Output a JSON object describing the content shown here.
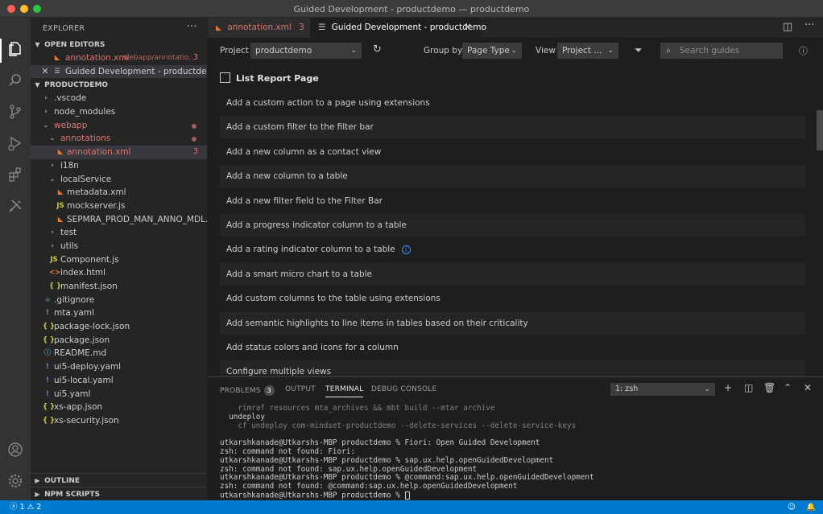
{
  "window": {
    "title": "Guided Development - productdemo — productdemo"
  },
  "sidebar": {
    "header": "EXPLORER",
    "more": "···",
    "open_editors": {
      "title": "OPEN EDITORS",
      "items": [
        {
          "name": "annotation.xml",
          "path": "webapp/annotatio...",
          "badge": "3"
        },
        {
          "name": "Guided Development - productdemo"
        }
      ]
    },
    "project": {
      "title": "PRODUCTDEMO",
      "tree": [
        {
          "label": ".vscode",
          "type": "folder"
        },
        {
          "label": "node_modules",
          "type": "folder"
        },
        {
          "label": "webapp",
          "type": "folder-open"
        },
        {
          "label": "annotations",
          "type": "folder-open"
        },
        {
          "label": "annotation.xml",
          "type": "xml",
          "badge": "3"
        },
        {
          "label": "i18n",
          "type": "folder"
        },
        {
          "label": "localService",
          "type": "folder-open"
        },
        {
          "label": "metadata.xml",
          "type": "xml"
        },
        {
          "label": "mockserver.js",
          "type": "js"
        },
        {
          "label": "SEPMRA_PROD_MAN_ANNO_MDL.xml",
          "type": "xml"
        },
        {
          "label": "test",
          "type": "folder"
        },
        {
          "label": "utils",
          "type": "folder"
        },
        {
          "label": "Component.js",
          "type": "js"
        },
        {
          "label": "index.html",
          "type": "html"
        },
        {
          "label": "manifest.json",
          "type": "json"
        },
        {
          "label": ".gitignore",
          "type": "git"
        },
        {
          "label": "mta.yaml",
          "type": "yaml"
        },
        {
          "label": "package-lock.json",
          "type": "json"
        },
        {
          "label": "package.json",
          "type": "json"
        },
        {
          "label": "README.md",
          "type": "info"
        },
        {
          "label": "ui5-deploy.yaml",
          "type": "yaml"
        },
        {
          "label": "ui5-local.yaml",
          "type": "yaml"
        },
        {
          "label": "ui5.yaml",
          "type": "yaml"
        },
        {
          "label": "xs-app.json",
          "type": "json"
        },
        {
          "label": "xs-security.json",
          "type": "json"
        }
      ]
    },
    "outline": "OUTLINE",
    "npm_scripts": "NPM SCRIPTS"
  },
  "tabs": [
    {
      "label": "annotation.xml",
      "badge": "3"
    },
    {
      "label": "Guided Development - productdemo"
    }
  ],
  "toolbar": {
    "project_label": "Project",
    "project_value": "productdemo",
    "group_by_label": "Group by",
    "group_by_value": "Page Type",
    "view_label": "View",
    "view_value": "Project ...",
    "search_placeholder": "Search guides"
  },
  "guides": {
    "section_title": "List Report Page",
    "items": [
      "Add a custom action to a page using extensions",
      "Add a custom filter to the filter bar",
      "Add a new column as a contact view",
      "Add a new column to a table",
      "Add a new filter field to the Filter Bar",
      "Add a progress indicator column to a table",
      "Add a rating indicator column to a table",
      "Add a smart micro chart to a table",
      "Add custom columns to the table using extensions",
      "Add semantic highlights to line items in tables based on their criticality",
      "Add status colors and icons for a column",
      "Configure multiple views"
    ]
  },
  "panel": {
    "tabs": [
      "PROBLEMS",
      "OUTPUT",
      "TERMINAL",
      "DEBUG CONSOLE"
    ],
    "problems_count": "3",
    "terminal_select": "1: zsh",
    "terminal_lines": [
      "    rimraf resources mta_archives && mbt build --mtar archive",
      "  undeploy",
      "    cf undeploy com-mindset-productdemo --delete-services --delete-service-keys",
      "",
      "utkarshkanade@Utkarshs-MBP productdemo % Fiori: Open Guided Development",
      "zsh: command not found: Fiori:",
      "utkarshkanade@Utkarshs-MBP productdemo % sap.ux.help.openGuidedDevelopment",
      "zsh: command not found: sap.ux.help.openGuidedDevelopment",
      "utkarshkanade@Utkarshs-MBP productdemo % @command:sap.ux.help.openGuidedDevelopment",
      "zsh: command not found: @command:sap.ux.help.openGuidedDevelopment",
      "utkarshkanade@Utkarshs-MBP productdemo % "
    ]
  },
  "statusbar": {
    "errors": "1",
    "warnings": "2"
  }
}
